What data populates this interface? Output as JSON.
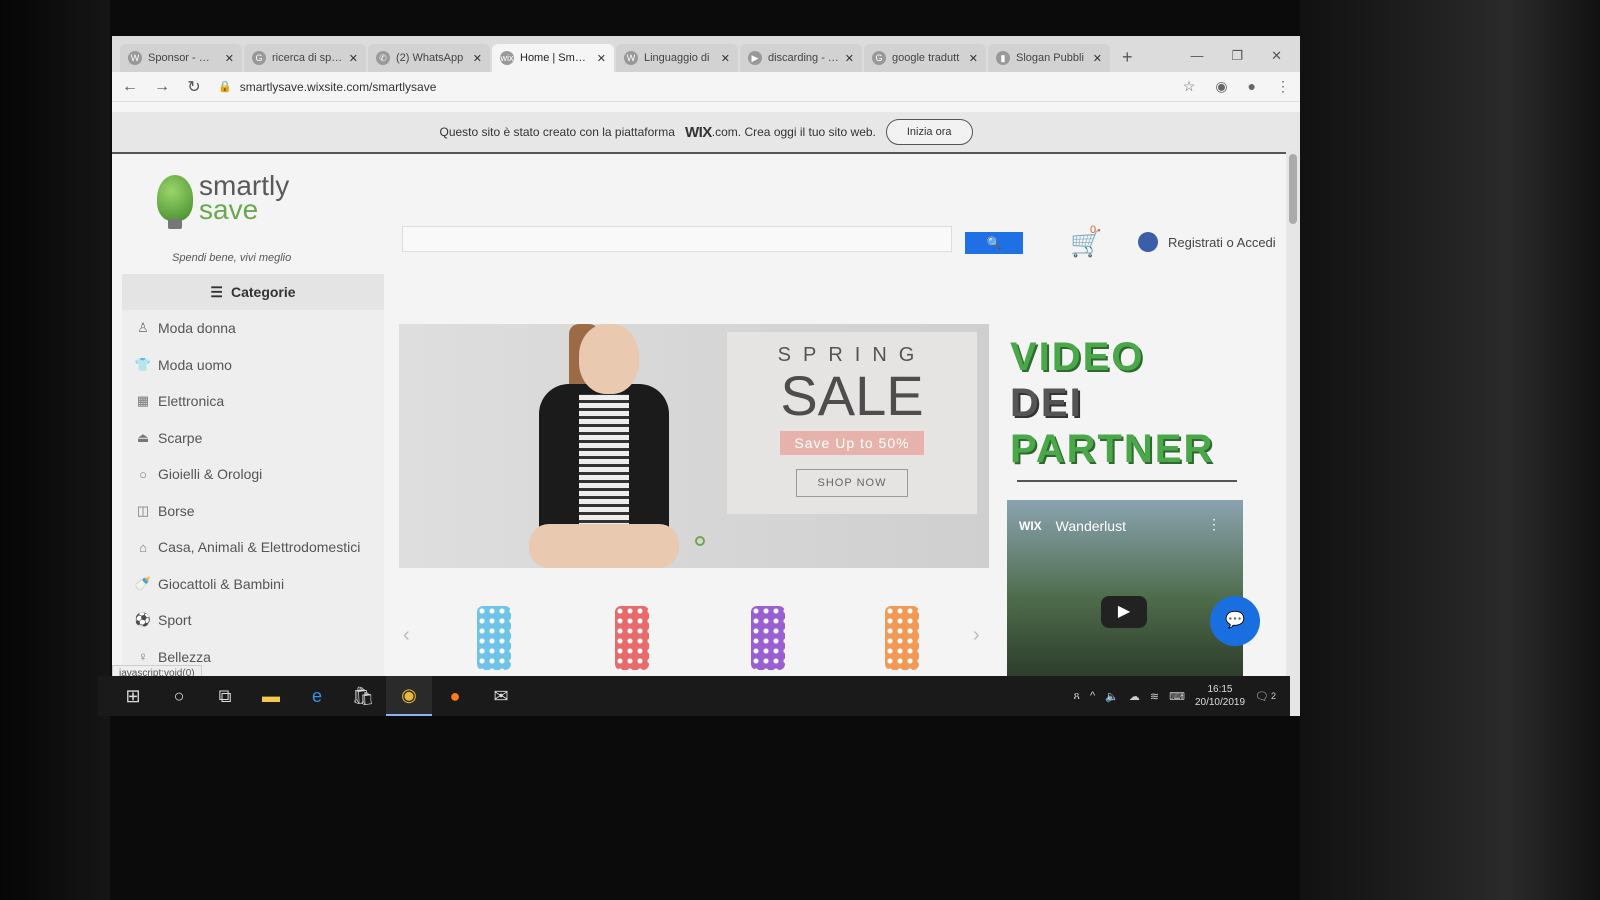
{
  "browser": {
    "tabs": [
      {
        "label": "Sponsor - Wiki",
        "favicon": "W",
        "active": false
      },
      {
        "label": "ricerca di sponsor",
        "favicon": "G",
        "active": false
      },
      {
        "label": "(2) WhatsApp",
        "favicon": "✆",
        "active": false
      },
      {
        "label": "Home | Smartly",
        "favicon": "wix",
        "active": true
      },
      {
        "label": "Linguaggio di",
        "favicon": "W",
        "active": false
      },
      {
        "label": "discarding - Yo",
        "favicon": "▶",
        "active": false
      },
      {
        "label": "google tradutt",
        "favicon": "G",
        "active": false
      },
      {
        "label": "Slogan Pubbli",
        "favicon": "▮",
        "active": false
      }
    ],
    "new_tab": "+",
    "url": "smartlysave.wixsite.com/smartlysave",
    "status_url": "javascript:void(0)"
  },
  "wix_banner": {
    "text_before": "Questo sito è stato creato con la piattaforma",
    "wix_brand": "WIX",
    "text_after": ".com. Crea oggi il tuo sito web.",
    "cta": "Inizia ora"
  },
  "site": {
    "logo_line1": "smartly",
    "logo_line2": "save",
    "slogan": "Spendi bene, vivi meglio",
    "search_icon": "search-icon",
    "cart_count": "0",
    "account_label": "Registrati o Accedi",
    "categories_title": "Categorie",
    "categories": [
      {
        "label": "Moda donna",
        "icon": "dress-icon"
      },
      {
        "label": "Moda uomo",
        "icon": "shirt-icon"
      },
      {
        "label": "Elettronica",
        "icon": "electronics-icon"
      },
      {
        "label": "Scarpe",
        "icon": "shoe-icon"
      },
      {
        "label": "Gioielli & Orologi",
        "icon": "ring-icon"
      },
      {
        "label": "Borse",
        "icon": "bag-icon"
      },
      {
        "label": "Casa, Animali & Elettrodomestici",
        "icon": "sofa-icon"
      },
      {
        "label": "Giocattoli & Bambini",
        "icon": "baby-bottle-icon"
      },
      {
        "label": "Sport",
        "icon": "ball-icon"
      },
      {
        "label": "Bellezza",
        "icon": "beauty-icon"
      }
    ],
    "hero": {
      "spring": "SPRING",
      "sale": "SALE",
      "save_up": "Save Up to 50%",
      "shop_now": "SHOP NOW"
    },
    "video_section": {
      "title_line1": "VIDEO",
      "title_line2": "DEI",
      "title_line3": "PARTNER",
      "video_brand": "WIX",
      "video_title": "Wanderlust"
    },
    "carousel_colors": [
      "#6fc3e8",
      "#e86a6a",
      "#9a5fd0",
      "#f29a55"
    ]
  },
  "taskbar": {
    "time": "16:15",
    "date": "20/10/2019",
    "notifications": "2"
  }
}
